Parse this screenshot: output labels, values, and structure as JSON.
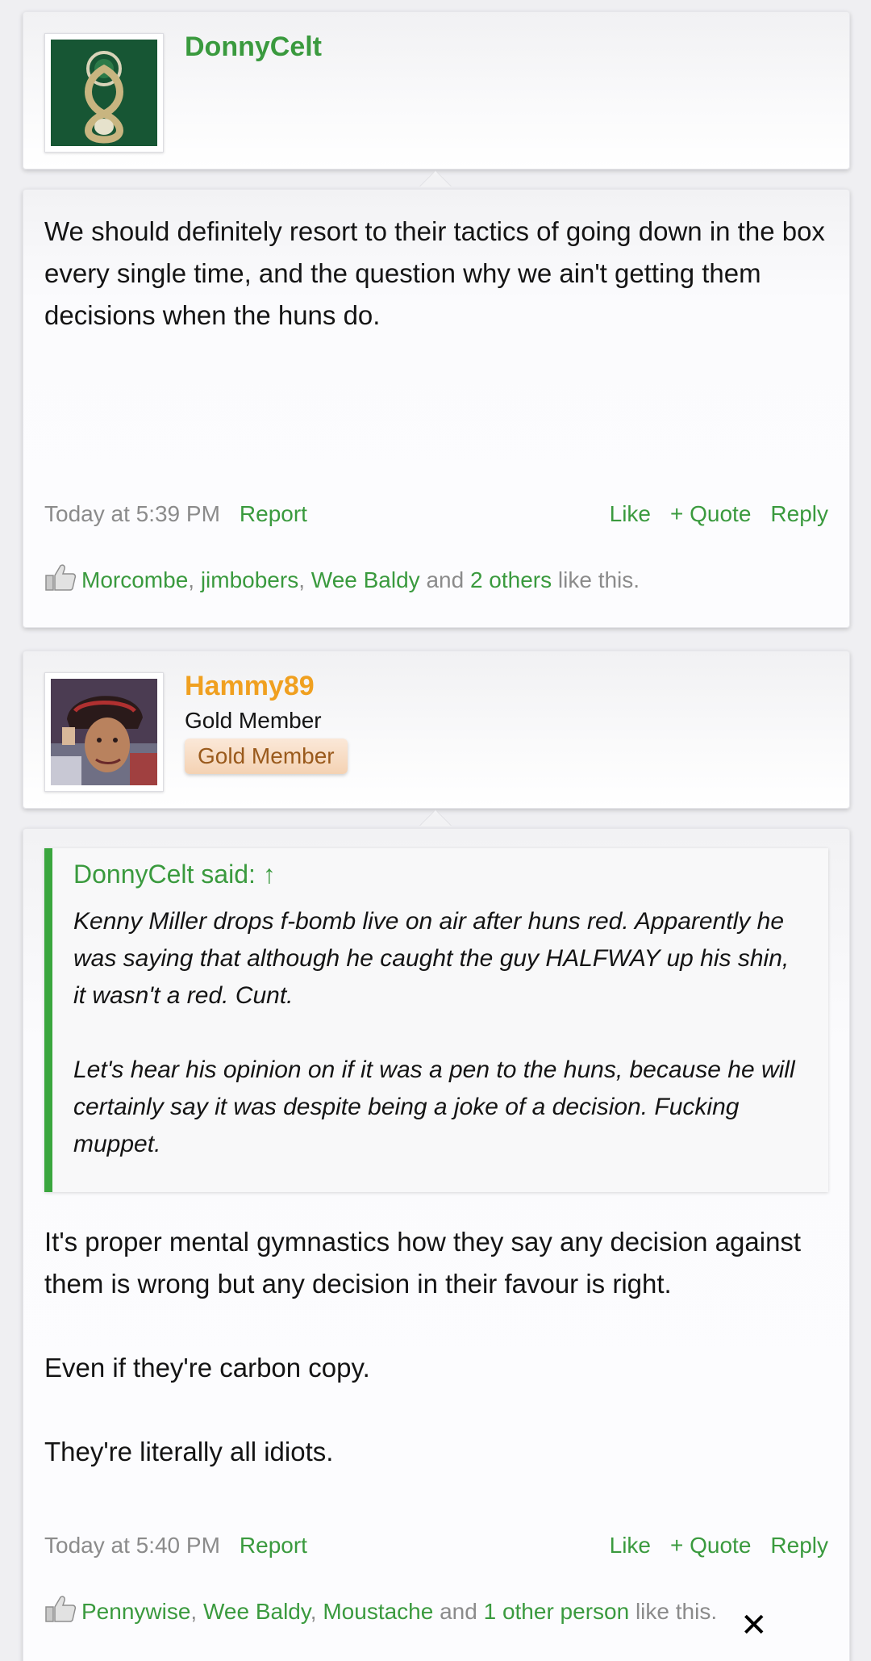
{
  "colors": {
    "link": "#3a9a3e",
    "username_gold": "#f0a020",
    "banner_text": "#9a5a1c"
  },
  "posts": [
    {
      "username": "DonnyCelt",
      "username_color": "#3a9a3e",
      "avatar_icon": "celtic-crest-avatar",
      "message": "We should definitely resort to their tactics of going down in the box every single time, and the question why we ain't getting them decisions when the huns do.",
      "time": "Today at 5:39 PM",
      "report": "Report",
      "like": "Like",
      "quote": "+ Quote",
      "reply": "Reply",
      "likers": [
        "Morcombe",
        "jimbobers",
        "Wee Baldy"
      ],
      "likes_and": "and",
      "likes_others": "2 others",
      "likes_suffix": "like this."
    },
    {
      "username": "Hammy89",
      "username_color": "#f0a020",
      "user_title": "Gold Member",
      "user_banner": "Gold Member",
      "avatar_icon": "user-photo-avatar",
      "quote_author": "DonnyCelt said: ↑",
      "quote_paragraphs": [
        "Kenny Miller drops f-bomb live on air after huns red. Apparently he was saying that although he caught the guy HALFWAY up his shin, it wasn't a red. Cunt.",
        "Let's hear his opinion on if it was a pen to the huns, because he will certainly say it was despite being a joke of a decision. Fucking muppet."
      ],
      "message_paragraphs": [
        "It's proper mental gymnastics how they say any decision against them is wrong but any decision in their favour is right.",
        "Even if they're carbon copy.",
        "They're literally all idiots."
      ],
      "time": "Today at 5:40 PM",
      "report": "Report",
      "like": "Like",
      "quote": "+ Quote",
      "reply": "Reply",
      "likers": [
        "Pennywise",
        "Wee Baldy",
        "Moustache"
      ],
      "likes_and": "and",
      "likes_others": "1 other person",
      "likes_suffix": "like this."
    }
  ],
  "overlay": {
    "close_glyph": "✕"
  }
}
